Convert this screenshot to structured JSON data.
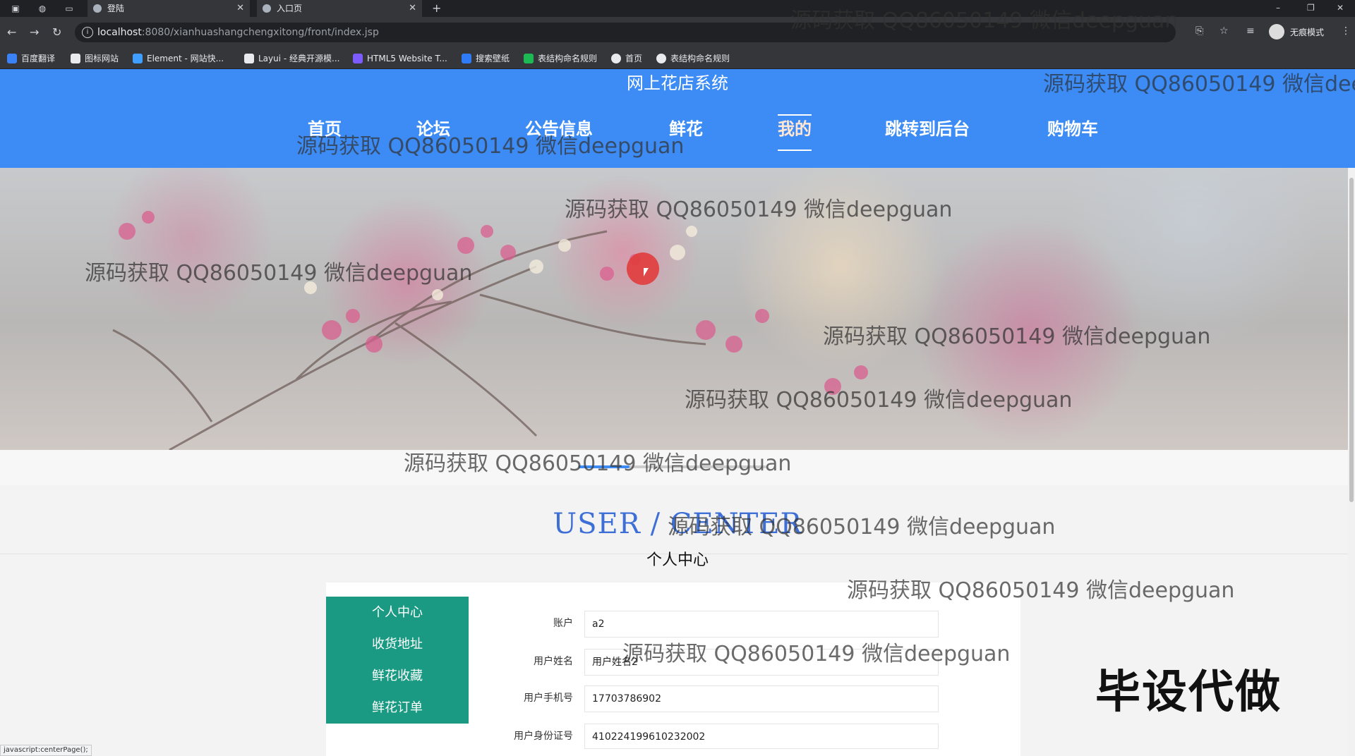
{
  "browser": {
    "tabs": [
      {
        "title": "登陆"
      },
      {
        "title": "入口页"
      }
    ],
    "url_host": "localhost",
    "url_path": ":8080/xianhuashangchengxitong/front/index.jsp",
    "incognito_label": "无痕模式",
    "bookmarks": [
      {
        "label": "百度翻译",
        "color": "#3b82f6"
      },
      {
        "label": "图标网站",
        "color": "#e8eaed"
      },
      {
        "label": "Element - 网站快...",
        "color": "#409eff"
      },
      {
        "label": "Layui - 经典开源模...",
        "color": "#e8eaed"
      },
      {
        "label": "HTML5 Website T...",
        "color": "#7c5cff"
      },
      {
        "label": "搜索壁纸",
        "color": "#2f7cf6"
      },
      {
        "label": "表结构命名规则",
        "color": "#1db954"
      },
      {
        "label": "首页",
        "color": "#e8eaed"
      },
      {
        "label": "表结构命名规则",
        "color": "#e8eaed"
      }
    ],
    "status_text": "javascript:centerPage();"
  },
  "site": {
    "title": "网上花店系统",
    "nav": [
      {
        "label": "首页"
      },
      {
        "label": "论坛"
      },
      {
        "label": "公告信息"
      },
      {
        "label": "鲜花"
      },
      {
        "label": "我的"
      },
      {
        "label": "跳转到后台"
      },
      {
        "label": "购物车"
      }
    ],
    "active_nav": "我的",
    "slider_progress": 0.27
  },
  "section": {
    "title_en": "USER / CENTER",
    "title_cn": "个人中心"
  },
  "side_menu": [
    {
      "label": "个人中心"
    },
    {
      "label": "收货地址"
    },
    {
      "label": "鲜花收藏"
    },
    {
      "label": "鲜花订单"
    }
  ],
  "form": {
    "fields": [
      {
        "label": "账户",
        "value": "a2"
      },
      {
        "label": "用户姓名",
        "value": "用户姓名2"
      },
      {
        "label": "用户手机号",
        "value": "17703786902"
      },
      {
        "label": "用户身份证号",
        "value": "410224199610232002"
      }
    ]
  },
  "watermark": {
    "text": "源码获取 QQ86050149 微信deepguan",
    "badge": "毕设代做"
  },
  "colors": {
    "header_blue": "#3d8cf5",
    "menu_green": "#1a9a82",
    "section_title_blue": "#3d6fd6"
  }
}
